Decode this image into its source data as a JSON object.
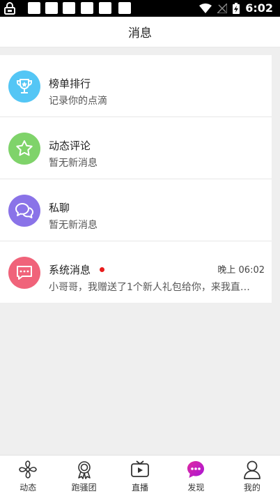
{
  "status_bar": {
    "time": "6:02"
  },
  "header": {
    "title": "消息"
  },
  "messages": [
    {
      "title": "榜单排行",
      "subtitle": "记录你的点滴",
      "icon": "trophy-icon",
      "color": "#54c6f5"
    },
    {
      "title": "动态评论",
      "subtitle": "暂无新消息",
      "icon": "star-icon",
      "color": "#7fd36a"
    },
    {
      "title": "私聊",
      "subtitle": "暂无新消息",
      "icon": "chat-bubbles-icon",
      "color": "#8a73e8"
    },
    {
      "title": "系统消息",
      "subtitle": "小哥哥，我赠送了1个新人礼包给你，来我直…",
      "icon": "message-icon",
      "color": "#f0637a",
      "time": "晚上 06:02",
      "unread": true
    }
  ],
  "tabs": [
    {
      "label": "动态",
      "icon": "pinwheel-icon"
    },
    {
      "label": "跑骚团",
      "icon": "badge-icon"
    },
    {
      "label": "直播",
      "icon": "tv-play-icon"
    },
    {
      "label": "发现",
      "icon": "discover-chat-icon",
      "active": true
    },
    {
      "label": "我的",
      "icon": "user-icon"
    }
  ],
  "colors": {
    "active_tab": "#c21cc9"
  }
}
